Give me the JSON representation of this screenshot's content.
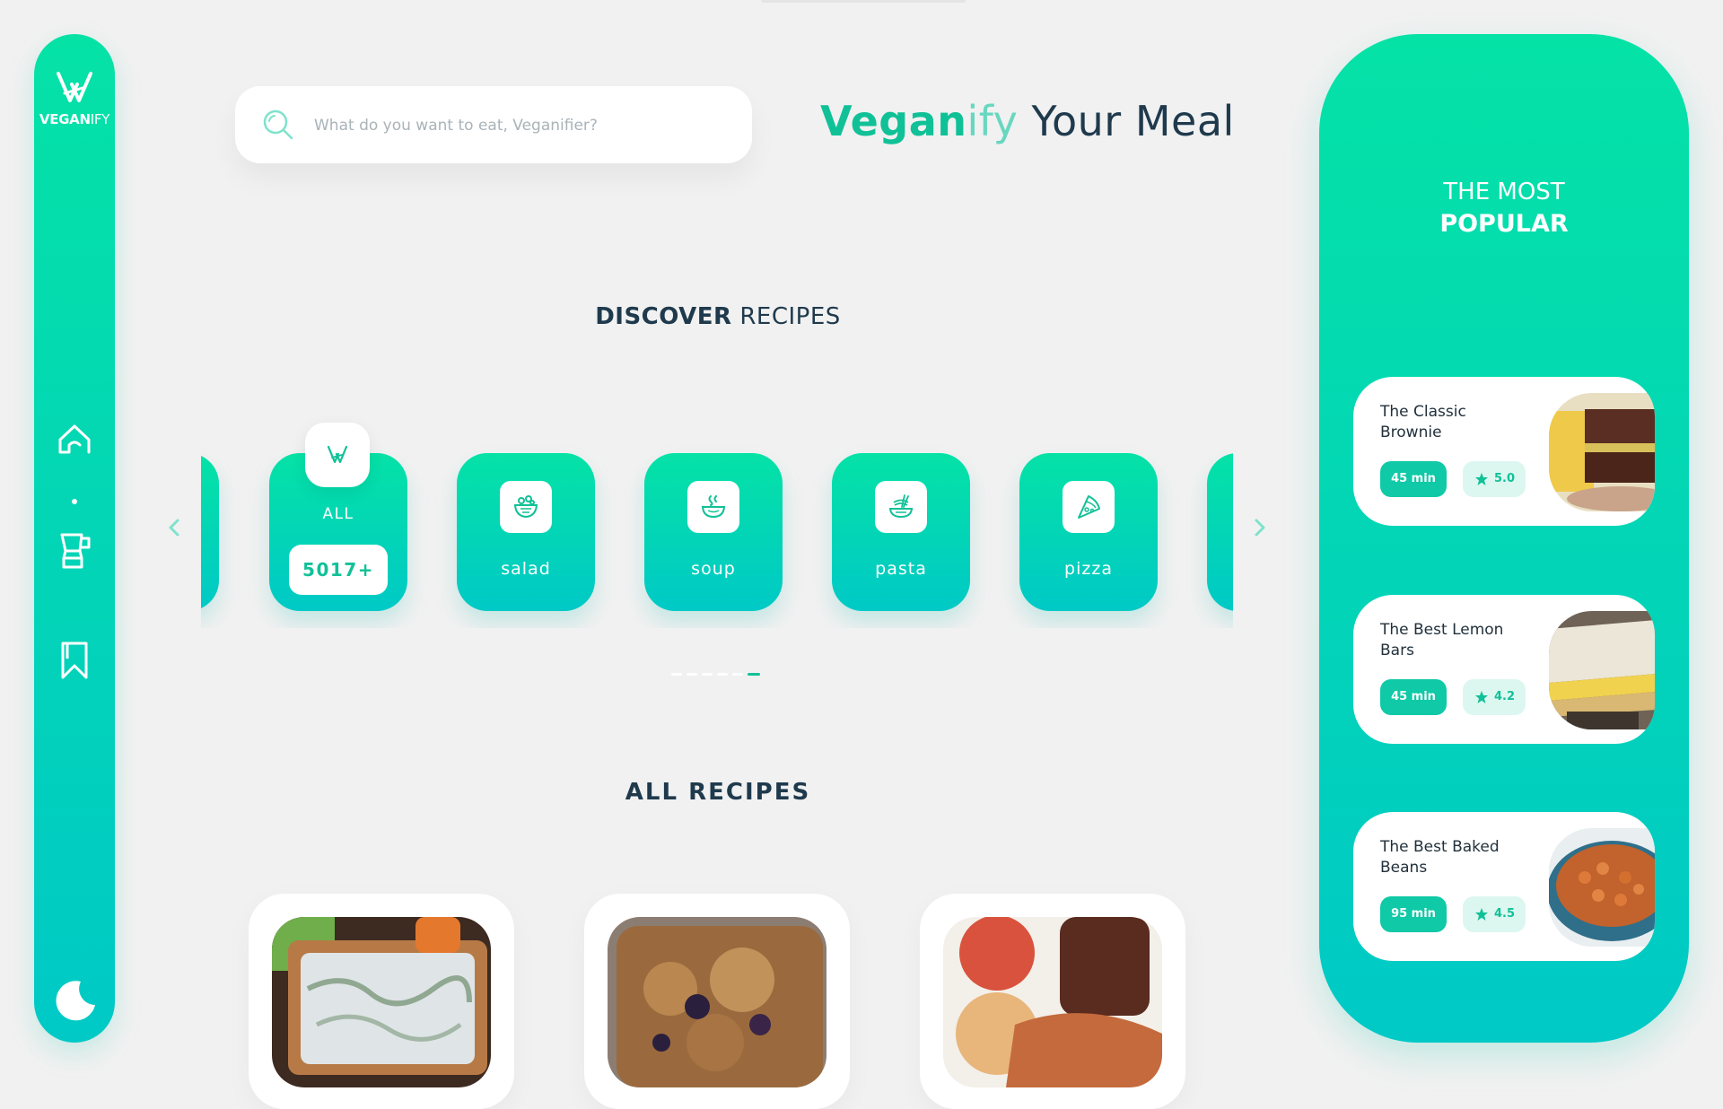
{
  "app": {
    "logo_bold": "VEGAN",
    "logo_light": "IFY"
  },
  "sidebar": {
    "items": [
      {
        "icon": "home-icon",
        "active": true
      },
      {
        "icon": "blender-icon"
      },
      {
        "icon": "bookmark-icon"
      }
    ],
    "theme_toggle_icon": "moon-icon"
  },
  "search": {
    "placeholder": "What do you want to eat, Veganifier?"
  },
  "headline": {
    "part1": "Vegan",
    "part2": "ify",
    "part3": " Your Meal"
  },
  "discover": {
    "title_bold": "DISCOVER",
    "title_light": " RECIPES",
    "all_label": "ALL",
    "all_count": "5017+",
    "categories": [
      {
        "label": "salad",
        "icon": "salad-icon"
      },
      {
        "label": "soup",
        "icon": "soup-icon"
      },
      {
        "label": "pasta",
        "icon": "pasta-icon"
      },
      {
        "label": "pizza",
        "icon": "pizza-icon"
      }
    ],
    "pagination": {
      "count": 6,
      "active": 6
    }
  },
  "all_recipes": {
    "title": "ALL RECIPES"
  },
  "popular": {
    "title_line1": "THE MOST",
    "title_line2": "POPULAR",
    "items": [
      {
        "name": "The Classic Brownie",
        "time": "45 min",
        "rating": "5.0"
      },
      {
        "name": "The Best Lemon Bars",
        "time": "45 min",
        "rating": "4.2"
      },
      {
        "name": "The Best Baked Beans",
        "time": "95 min",
        "rating": "4.5"
      }
    ]
  },
  "colors": {
    "accent": "#10c197",
    "gradient_top": "#05e2a6",
    "gradient_bottom": "#00c9c6",
    "text_dark": "#1f3a4d",
    "background": "#f1f1f1"
  }
}
